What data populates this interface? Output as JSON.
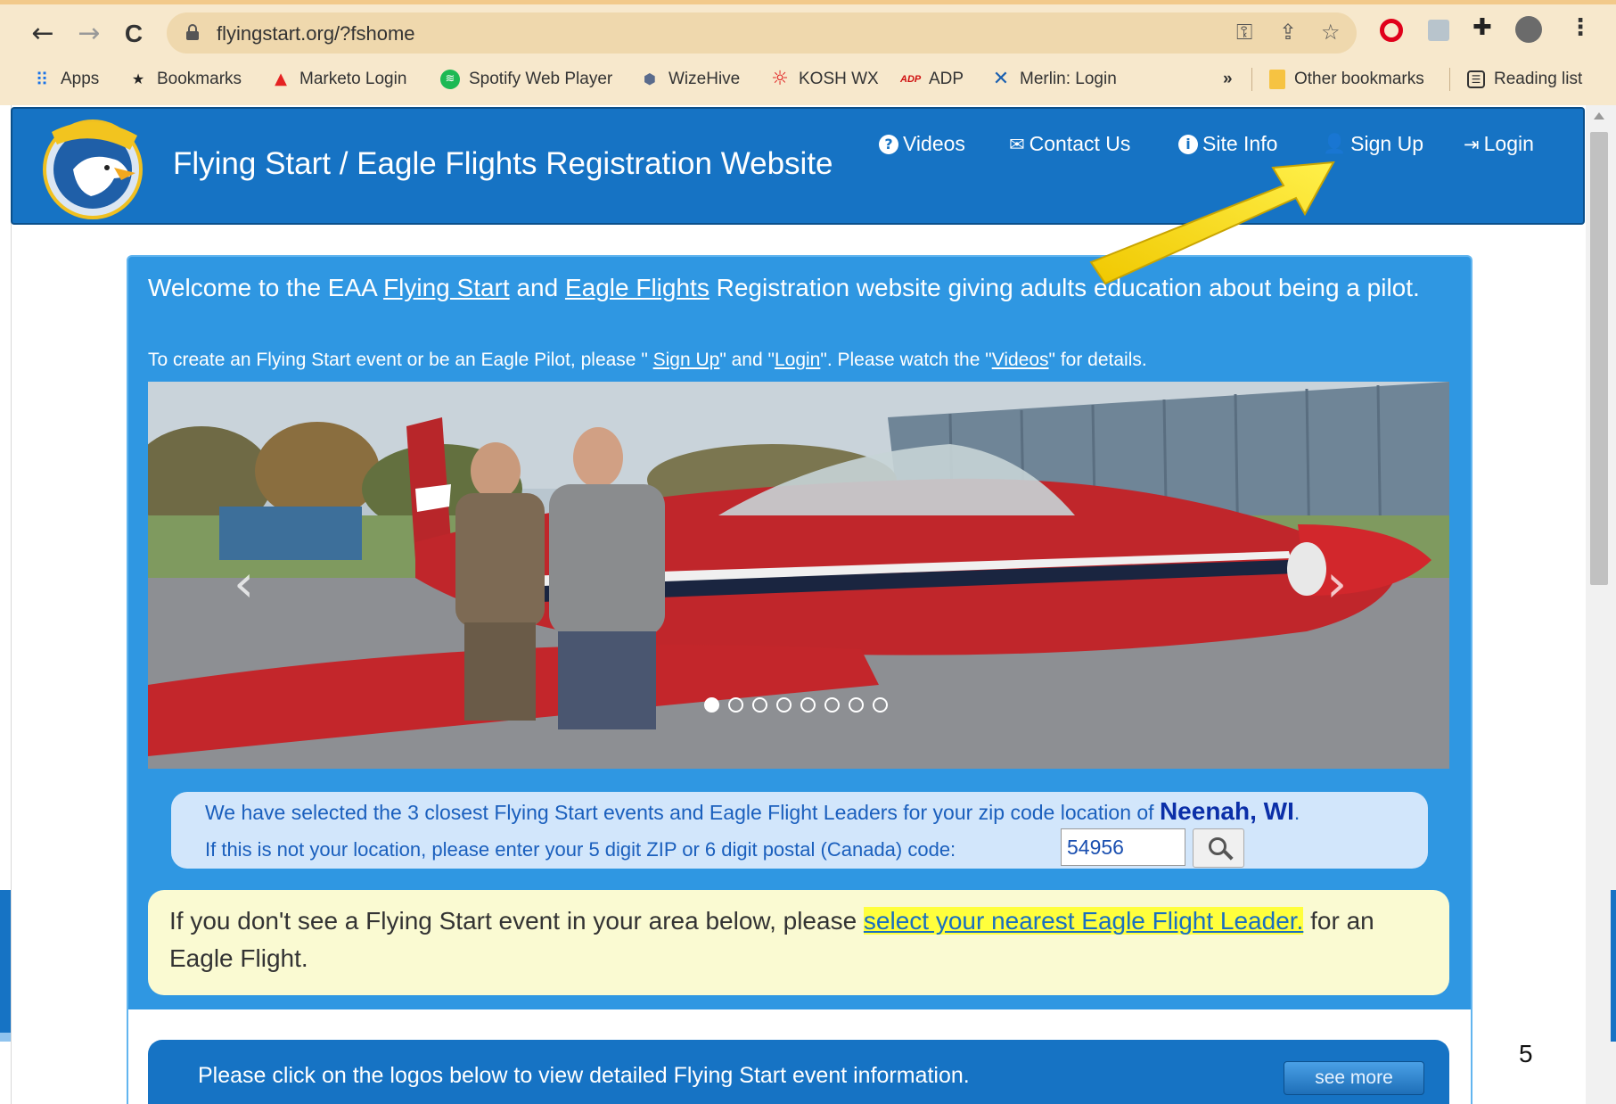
{
  "browser": {
    "url": "flyingstart.org/?fshome",
    "nav": {
      "back": "←",
      "forward": "→",
      "reload": "C"
    },
    "bookmarks": [
      {
        "label": "Apps",
        "icon": "apps-grid-icon"
      },
      {
        "label": "Bookmarks",
        "icon": "star-icon"
      },
      {
        "label": "Marketo Login",
        "icon": "marketo-icon"
      },
      {
        "label": "Spotify Web Player",
        "icon": "spotify-icon"
      },
      {
        "label": "WizeHive",
        "icon": "wizehive-icon"
      },
      {
        "label": "KOSH WX",
        "icon": "sun-icon"
      },
      {
        "label": "ADP",
        "icon": "adp-icon"
      },
      {
        "label": "Merlin: Login",
        "icon": "merlin-icon"
      }
    ],
    "overflow": "»",
    "other_bookmarks": "Other bookmarks",
    "reading_list": "Reading list"
  },
  "site": {
    "title": "Flying Start / Eagle Flights Registration Website",
    "logo_alt": "MENTOR PILOT EAGLE FLIGHTS",
    "nav": [
      {
        "label": "Videos",
        "icon": "question-circle-icon"
      },
      {
        "label": "Contact Us",
        "icon": "envelope-icon"
      },
      {
        "label": "Site Info",
        "icon": "info-circle-icon"
      },
      {
        "label": "Sign Up",
        "icon": "user-icon"
      },
      {
        "label": "Login",
        "icon": "login-icon"
      }
    ]
  },
  "welcome": {
    "part1": "Welcome to the EAA ",
    "link1": "Flying Start",
    "part2": " and ",
    "link2": "Eagle Flights",
    "part3": " Registration website giving adults education about being a pilot."
  },
  "instructions": {
    "part1": "To create an Flying Start event or be an Eagle Pilot, please \" ",
    "link_signup": "Sign Up",
    "part2": "\" and \"",
    "link_login": "Login",
    "part3": "\". Please watch the \"",
    "link_videos": "Videos",
    "part4": "\" for details."
  },
  "carousel": {
    "slide_count": 8,
    "active_index": 0,
    "prev": "‹",
    "next": "›"
  },
  "location": {
    "line1": "We have selected the 3 closest Flying Start events and Eagle Flight Leaders for your zip code location of ",
    "city": "Neenah, WI",
    "line1_end": ".",
    "line2": "If this is not your location, please enter your 5 digit ZIP or 6 digit postal (Canada) code:",
    "zip": "54956"
  },
  "note": {
    "part1": "If you don't see a Flying Start event in your area below, please ",
    "link": "select your nearest Eagle Flight Leader.",
    "part2": " for an Eagle Flight."
  },
  "events_bar": {
    "text": "Please click on the logos below to view detailed Flying Start event information.",
    "see_more": "see more"
  },
  "slide_number": "5",
  "colors": {
    "header_blue": "#1673c4",
    "panel_blue": "#2f97e2",
    "highlight": "#ffff3c",
    "arrow": "#f5d90a"
  }
}
